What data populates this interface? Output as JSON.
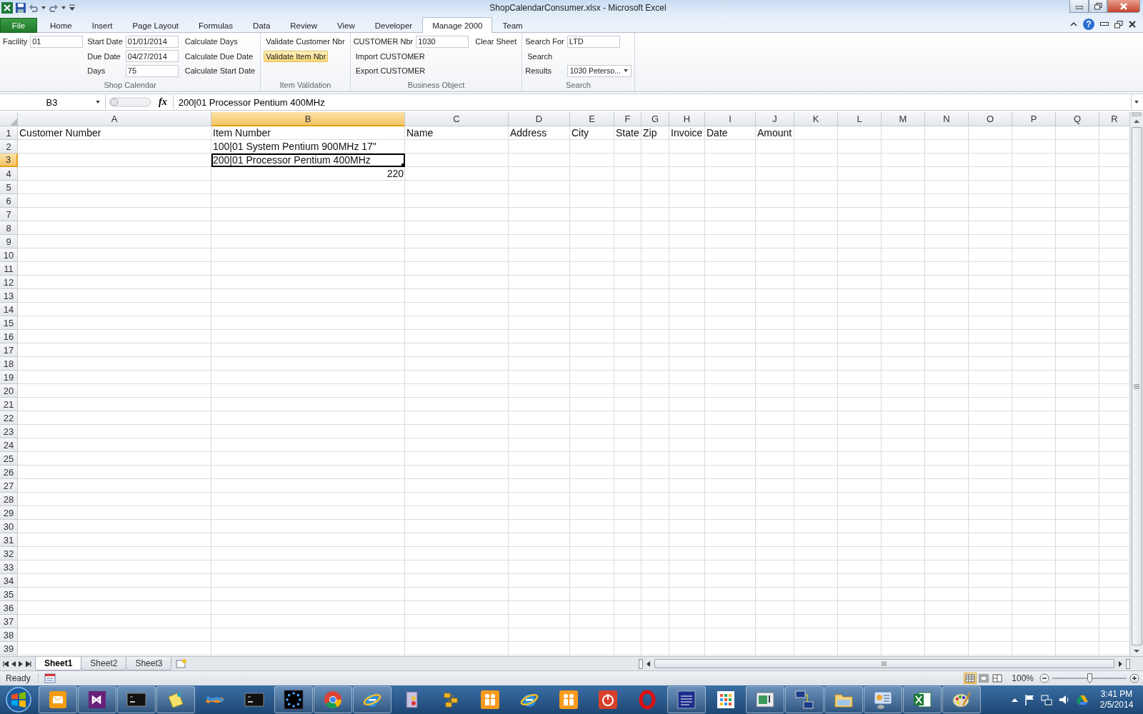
{
  "window": {
    "title": "ShopCalendarConsumer.xlsx - Microsoft Excel"
  },
  "ribbon": {
    "file_tab": "File",
    "help": "?",
    "tabs": [
      {
        "label": "Home",
        "selected": false
      },
      {
        "label": "Insert",
        "selected": false
      },
      {
        "label": "Page Layout",
        "selected": false
      },
      {
        "label": "Formulas",
        "selected": false
      },
      {
        "label": "Data",
        "selected": false
      },
      {
        "label": "Review",
        "selected": false
      },
      {
        "label": "View",
        "selected": false
      },
      {
        "label": "Developer",
        "selected": false
      },
      {
        "label": "Manage 2000",
        "selected": true
      },
      {
        "label": "Team",
        "selected": false
      }
    ],
    "groups": [
      {
        "label": "Shop Calendar",
        "columns": [
          [
            {
              "kind": "field",
              "label": "Facility",
              "value": "01"
            }
          ],
          [
            {
              "kind": "field",
              "label": "Start Date",
              "value": "01/01/2014"
            },
            {
              "kind": "field",
              "label": "Due Date",
              "value": "04/27/2014"
            },
            {
              "kind": "field",
              "label": "Days",
              "value": "75"
            }
          ],
          [
            {
              "kind": "button",
              "label": "Calculate Days",
              "highlighted": false
            },
            {
              "kind": "button",
              "label": "Calculate Due Date",
              "highlighted": false
            },
            {
              "kind": "button",
              "label": "Calculate Start Date",
              "highlighted": false
            }
          ]
        ]
      },
      {
        "label": "Item Validation",
        "columns": [
          [
            {
              "kind": "button",
              "label": "Validate Customer Nbr",
              "highlighted": false
            },
            {
              "kind": "button",
              "label": "Validate Item Nbr",
              "highlighted": true
            }
          ]
        ]
      },
      {
        "label": "Business Object",
        "columns": [
          [
            {
              "kind": "field",
              "label": "CUSTOMER Nbr",
              "value": "1030"
            },
            {
              "kind": "button",
              "label": "Import CUSTOMER",
              "highlighted": false
            },
            {
              "kind": "button",
              "label": "Export CUSTOMER",
              "highlighted": false
            }
          ],
          [
            {
              "kind": "button",
              "label": "Clear Sheet",
              "highlighted": false
            }
          ]
        ]
      },
      {
        "label": "Search",
        "columns": [
          [
            {
              "kind": "field",
              "label": "Search For",
              "value": "LTD"
            },
            {
              "kind": "button",
              "label": "Search",
              "highlighted": false
            },
            {
              "kind": "dropdown",
              "label": "Results",
              "value": "1030 Peterso..."
            }
          ]
        ]
      }
    ]
  },
  "formula_bar": {
    "name_box": "B3",
    "fx": "fx",
    "formula": "200|01 Processor Pentium 400MHz"
  },
  "sheet": {
    "columns": [
      {
        "label": "A",
        "selected": false
      },
      {
        "label": "B",
        "selected": true
      },
      {
        "label": "C",
        "selected": false
      },
      {
        "label": "D",
        "selected": false
      },
      {
        "label": "E",
        "selected": false
      },
      {
        "label": "F",
        "selected": false
      },
      {
        "label": "G",
        "selected": false
      },
      {
        "label": "H",
        "selected": false
      },
      {
        "label": "I",
        "selected": false
      },
      {
        "label": "J",
        "selected": false
      },
      {
        "label": "K",
        "selected": false
      },
      {
        "label": "L",
        "selected": false
      },
      {
        "label": "M",
        "selected": false
      },
      {
        "label": "N",
        "selected": false
      },
      {
        "label": "O",
        "selected": false
      },
      {
        "label": "P",
        "selected": false
      },
      {
        "label": "Q",
        "selected": false
      },
      {
        "label": "R",
        "selected": false
      }
    ],
    "rows": [
      {
        "number": "1",
        "selected": false,
        "cells": [
          {
            "text": "Customer Number",
            "kind": "text",
            "active": false
          },
          {
            "text": "Item Number",
            "kind": "text",
            "active": false
          },
          {
            "text": "Name",
            "kind": "text",
            "active": false
          },
          {
            "text": "Address",
            "kind": "text",
            "active": false
          },
          {
            "text": "City",
            "kind": "text",
            "active": false
          },
          {
            "text": "State",
            "kind": "text",
            "active": false
          },
          {
            "text": "Zip",
            "kind": "text",
            "active": false
          },
          {
            "text": "Invoice",
            "kind": "text",
            "active": false
          },
          {
            "text": "Date",
            "kind": "text",
            "active": false
          },
          {
            "text": "Amount",
            "kind": "text",
            "active": false
          }
        ]
      },
      {
        "number": "2",
        "selected": false,
        "cells": [
          null,
          {
            "text": "100|01 System Pentium 900MHz 17\"",
            "kind": "text",
            "active": false
          }
        ]
      },
      {
        "number": "3",
        "selected": true,
        "cells": [
          null,
          {
            "text": "200|01 Processor Pentium 400MHz",
            "kind": "text",
            "active": true
          }
        ]
      },
      {
        "number": "4",
        "selected": false,
        "cells": [
          null,
          {
            "text": "220",
            "kind": "number",
            "active": false
          }
        ]
      },
      {
        "number": "5",
        "selected": false
      },
      {
        "number": "6",
        "selected": false
      },
      {
        "number": "7",
        "selected": false
      },
      {
        "number": "8",
        "selected": false
      },
      {
        "number": "9",
        "selected": false
      },
      {
        "number": "10",
        "selected": false
      },
      {
        "number": "11",
        "selected": false
      },
      {
        "number": "12",
        "selected": false
      },
      {
        "number": "13",
        "selected": false
      },
      {
        "number": "14",
        "selected": false
      },
      {
        "number": "15",
        "selected": false
      },
      {
        "number": "16",
        "selected": false
      },
      {
        "number": "17",
        "selected": false
      },
      {
        "number": "18",
        "selected": false
      },
      {
        "number": "19",
        "selected": false
      },
      {
        "number": "20",
        "selected": false
      },
      {
        "number": "21",
        "selected": false
      },
      {
        "number": "22",
        "selected": false
      },
      {
        "number": "23",
        "selected": false
      },
      {
        "number": "24",
        "selected": false
      },
      {
        "number": "25",
        "selected": false
      },
      {
        "number": "26",
        "selected": false
      },
      {
        "number": "27",
        "selected": false
      },
      {
        "number": "28",
        "selected": false
      },
      {
        "number": "29",
        "selected": false
      },
      {
        "number": "30",
        "selected": false
      },
      {
        "number": "31",
        "selected": false
      },
      {
        "number": "32",
        "selected": false
      },
      {
        "number": "33",
        "selected": false
      },
      {
        "number": "34",
        "selected": false
      },
      {
        "number": "35",
        "selected": false
      },
      {
        "number": "36",
        "selected": false
      },
      {
        "number": "37",
        "selected": false
      },
      {
        "number": "38",
        "selected": false
      },
      {
        "number": "39",
        "selected": false
      }
    ]
  },
  "sheet_tabs": [
    {
      "label": "Sheet1",
      "selected": true
    },
    {
      "label": "Sheet2",
      "selected": false
    },
    {
      "label": "Sheet3",
      "selected": false
    }
  ],
  "status_bar": {
    "status": "Ready",
    "views": [
      {
        "kind": "normal",
        "selected": true
      },
      {
        "kind": "page-layout",
        "selected": false
      },
      {
        "kind": "page-break",
        "selected": false
      }
    ],
    "zoom": "100%",
    "zoom_slider": {
      "level": 0.5
    }
  },
  "taskbar": {
    "apps": [
      {
        "kind": "mail",
        "running": true
      },
      {
        "kind": "vs",
        "running": true
      },
      {
        "kind": "terminal",
        "running": true
      },
      {
        "kind": "note",
        "running": true
      },
      {
        "kind": "ribbon",
        "running": false
      },
      {
        "kind": "terminal",
        "running": false
      },
      {
        "kind": "starring",
        "running": true
      },
      {
        "kind": "chrome",
        "running": true
      },
      {
        "kind": "ie",
        "running": true
      },
      {
        "kind": "notebook",
        "running": false
      },
      {
        "kind": "netblocks",
        "running": false
      },
      {
        "kind": "people",
        "running": false
      },
      {
        "kind": "ie",
        "running": false
      },
      {
        "kind": "people",
        "running": false
      },
      {
        "kind": "power",
        "running": false
      },
      {
        "kind": "opera",
        "running": false
      },
      {
        "kind": "doclist",
        "running": true
      },
      {
        "kind": "grid",
        "running": false
      },
      {
        "kind": "window",
        "running": true
      },
      {
        "kind": "netpc",
        "running": true
      },
      {
        "kind": "folder",
        "running": true
      },
      {
        "kind": "cpanel",
        "running": true
      },
      {
        "kind": "excel",
        "running": true
      },
      {
        "kind": "paint",
        "running": true
      }
    ],
    "time": "3:41 PM",
    "date": "2/5/2014"
  }
}
